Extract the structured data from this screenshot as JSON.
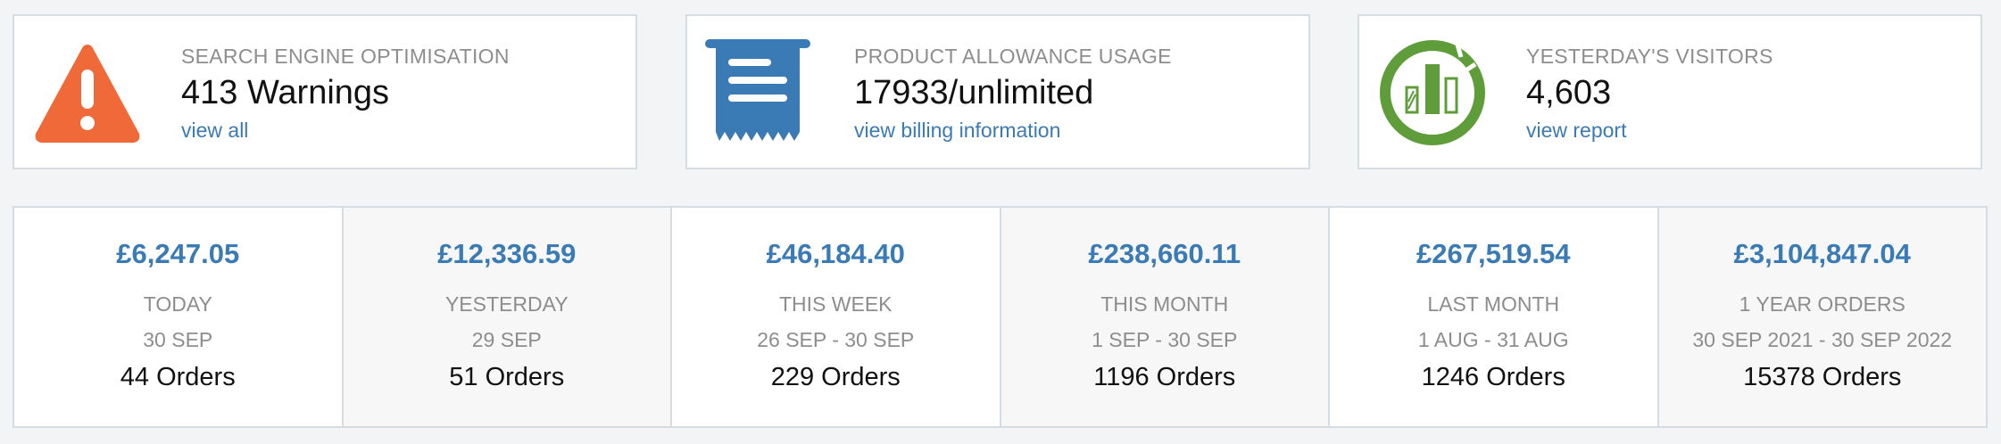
{
  "colors": {
    "warning_orange": "#f06a39",
    "billing_blue": "#3a7ab5",
    "visitors_green": "#5e9d3a",
    "link_blue": "#3a7ab5"
  },
  "cards": [
    {
      "icon": "warning-triangle-icon",
      "label": "Search Engine Optimisation",
      "value": "413 Warnings",
      "link": "view all"
    },
    {
      "icon": "receipt-icon",
      "label": "Product Allowance Usage",
      "value": "17933/unlimited",
      "link": "view billing information"
    },
    {
      "icon": "analytics-chart-icon",
      "label": "Yesterday's Visitors",
      "value": "4,603",
      "link": "view report"
    }
  ],
  "stats": [
    {
      "amount": "£6,247.05",
      "period": "Today",
      "dates": "30 SEP",
      "orders": "44 Orders"
    },
    {
      "amount": "£12,336.59",
      "period": "Yesterday",
      "dates": "29 SEP",
      "orders": "51 Orders"
    },
    {
      "amount": "£46,184.40",
      "period": "This Week",
      "dates": "26 SEP - 30 SEP",
      "orders": "229 Orders"
    },
    {
      "amount": "£238,660.11",
      "period": "This Month",
      "dates": "1 SEP - 30 SEP",
      "orders": "1196 Orders"
    },
    {
      "amount": "£267,519.54",
      "period": "Last Month",
      "dates": "1 AUG - 31 AUG",
      "orders": "1246 Orders"
    },
    {
      "amount": "£3,104,847.04",
      "period": "1 Year Orders",
      "dates": "30 SEP 2021 - 30 SEP 2022",
      "orders": "15378 Orders"
    }
  ]
}
